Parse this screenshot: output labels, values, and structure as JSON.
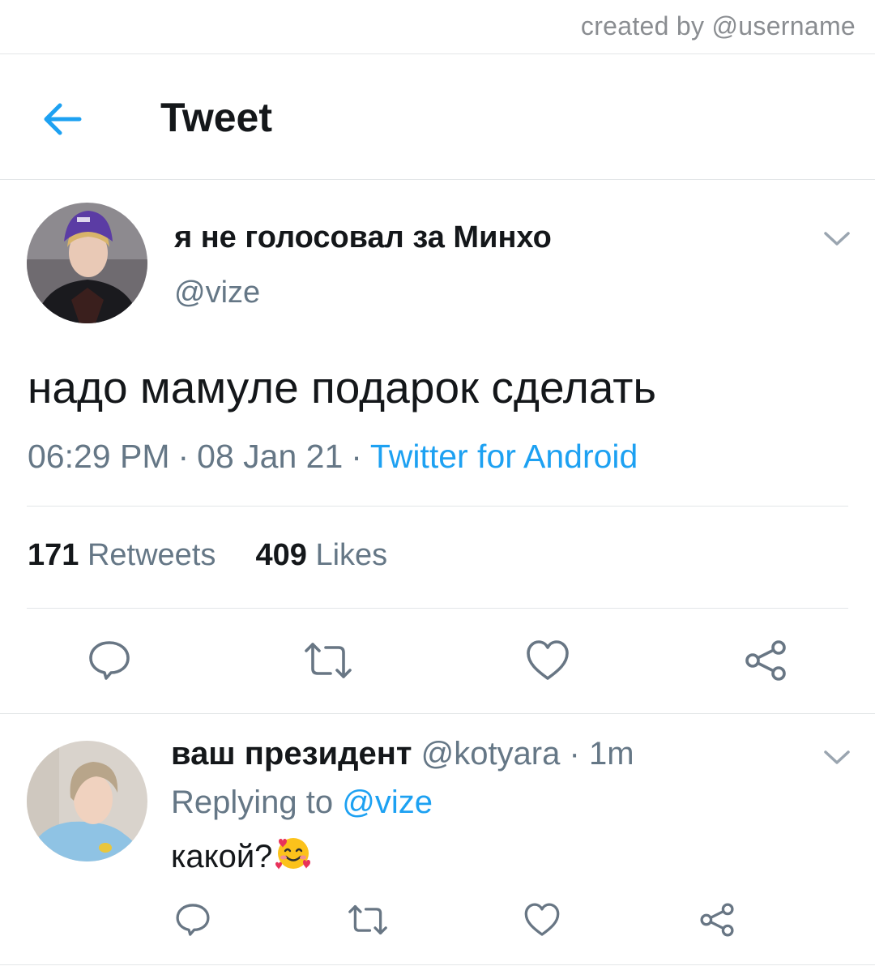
{
  "credit": "created by @username",
  "header": {
    "title": "Tweet",
    "back_icon": "arrow-left-icon"
  },
  "tweet": {
    "display_name": "я не голосовал за Минхо",
    "handle": "@vize",
    "text": "надо мамуле подарок сделать",
    "time": "06:29 PM",
    "separator": "·",
    "date": "08 Jan 21",
    "source": "Twitter for Android",
    "retweets_count": "171",
    "retweets_label": "Retweets",
    "likes_count": "409",
    "likes_label": "Likes",
    "actions": [
      "reply-icon",
      "retweet-icon",
      "like-icon",
      "share-icon"
    ]
  },
  "reply": {
    "display_name": "ваш президент",
    "handle": "@kotyara",
    "separator": "·",
    "time": "1m",
    "replying_to_label": "Replying to",
    "replying_to_handle": "@vize",
    "text": "какой?",
    "emoji": "smiling-face-with-hearts",
    "actions": [
      "reply-icon",
      "retweet-icon",
      "like-icon",
      "share-icon"
    ]
  },
  "colors": {
    "accent": "#1da1f2",
    "text_primary": "#14171a",
    "text_secondary": "#657786",
    "divider": "#e3e6e8",
    "icon": "#687684"
  }
}
